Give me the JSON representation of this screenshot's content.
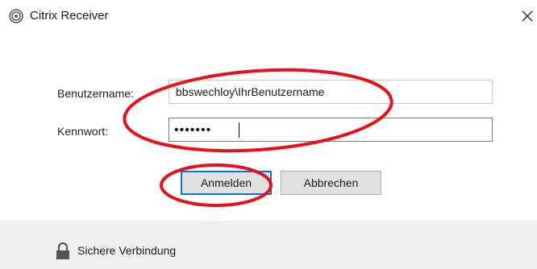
{
  "window": {
    "title": "Citrix Receiver",
    "title_icon": "citrix-logo-icon",
    "close_icon": "close-icon"
  },
  "form": {
    "username_label": "Benutzername:",
    "username_value": "bbswechloy\\IhrBenutzername",
    "password_label": "Kennwort:",
    "password_masked": "•••••••"
  },
  "buttons": {
    "login_label": "Anmelden",
    "cancel_label": "Abbrechen"
  },
  "footer": {
    "lock_icon": "lock-icon",
    "status_text": "Sichere Verbindung"
  },
  "colors": {
    "annotation": "#e8101a",
    "focus_border": "#0078d7",
    "footer_bg": "#f0f0f0"
  }
}
